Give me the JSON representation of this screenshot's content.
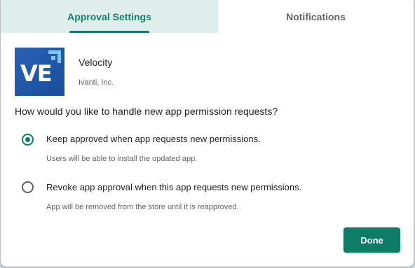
{
  "tabs": [
    {
      "label": "Approval Settings",
      "active": true
    },
    {
      "label": "Notifications",
      "active": false
    }
  ],
  "app": {
    "logo_text": "VE",
    "name": "Velocity",
    "publisher": "Ivanti, Inc."
  },
  "question": "How would you like to handle new app permission requests?",
  "options": [
    {
      "label": "Keep approved when app requests new permissions.",
      "description": "Users will be able to install the updated app.",
      "selected": true
    },
    {
      "label": "Revoke app approval when this app requests new permissions.",
      "description": "App will be removed from the store until it is reapproved.",
      "selected": false
    }
  ],
  "done_label": "Done",
  "colors": {
    "accent": "#0f7c68",
    "active_tab_bg": "#dfeeeb",
    "logo_blue": "#1f55a5"
  }
}
